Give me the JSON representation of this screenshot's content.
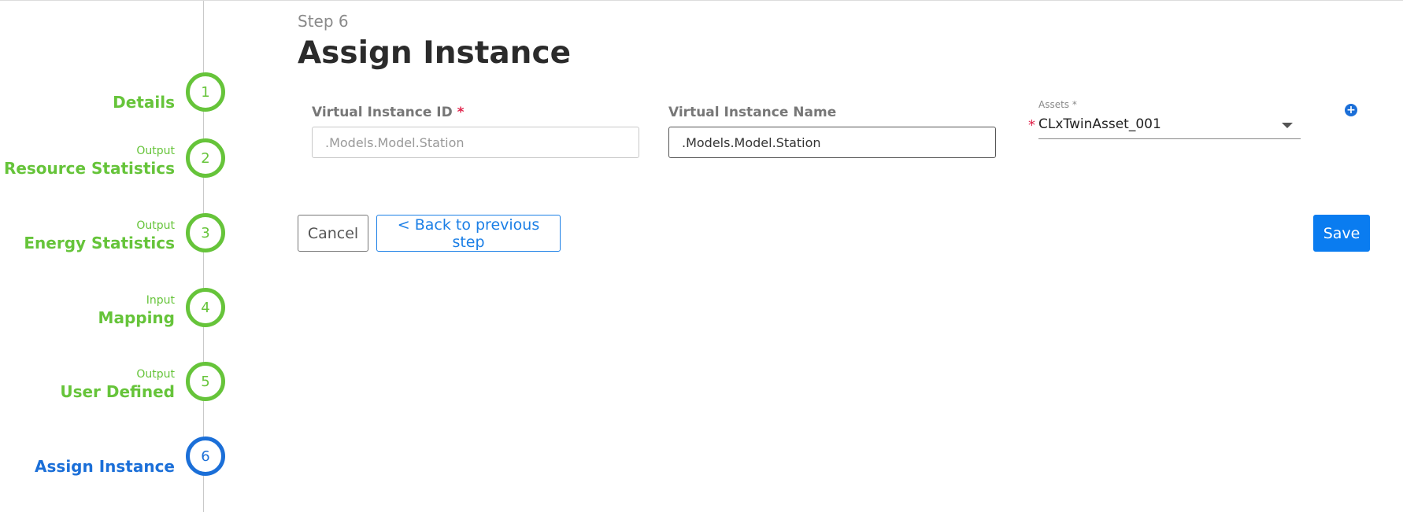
{
  "stepper": {
    "steps": [
      {
        "number": "1",
        "sub": "",
        "title": "Details",
        "state": "complete"
      },
      {
        "number": "2",
        "sub": "Output",
        "title": "Resource Statistics",
        "state": "complete"
      },
      {
        "number": "3",
        "sub": "Output",
        "title": "Energy Statistics",
        "state": "complete"
      },
      {
        "number": "4",
        "sub": "Input",
        "title": "Mapping",
        "state": "complete"
      },
      {
        "number": "5",
        "sub": "Output",
        "title": "User Defined",
        "state": "complete"
      },
      {
        "number": "6",
        "sub": "",
        "title": "Assign Instance",
        "state": "active"
      }
    ]
  },
  "main": {
    "step_label": "Step 6",
    "title": "Assign Instance",
    "fields": {
      "vi_id": {
        "label": "Virtual Instance ID",
        "required_mark": "*",
        "value": "",
        "placeholder": ".Models.Model.Station"
      },
      "vi_name": {
        "label": "Virtual Instance Name",
        "value": ".Models.Model.Station"
      },
      "assets": {
        "label": "Assets *",
        "required_mark": "*",
        "value": "CLxTwinAsset_001"
      }
    },
    "buttons": {
      "cancel": "Cancel",
      "back": "< Back to previous step",
      "save": "Save"
    }
  },
  "colors": {
    "complete": "#66c43a",
    "active": "#1b6fd8",
    "primary": "#0a7cf0",
    "required": "#e0224a"
  },
  "icons": {
    "add": "plus-circle-icon",
    "dropdown": "caret-down-icon"
  }
}
